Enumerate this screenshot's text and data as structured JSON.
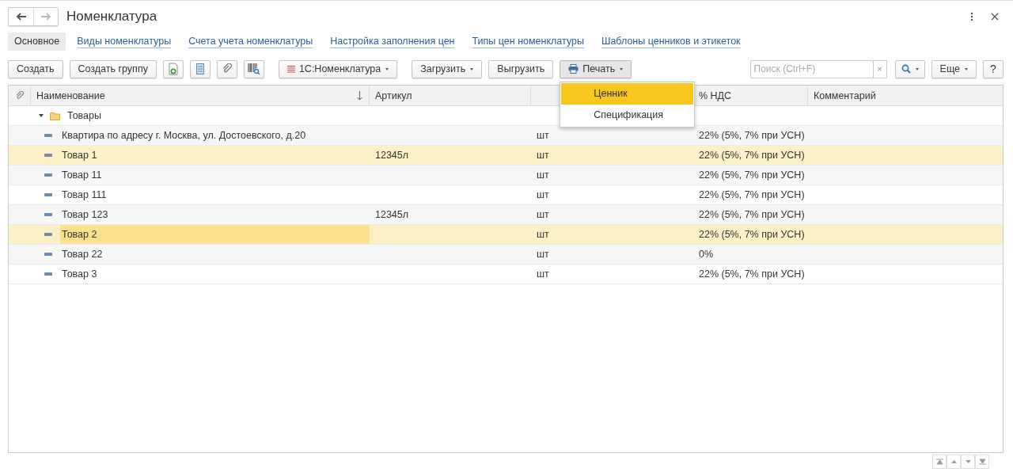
{
  "window": {
    "title": "Номенклатура"
  },
  "nav": {
    "back_disabled": false,
    "forward_disabled": true
  },
  "tabs": [
    {
      "label": "Основное",
      "selected": true
    },
    {
      "label": "Виды номенклатуры",
      "selected": false
    },
    {
      "label": "Счета учета номенклатуры",
      "selected": false
    },
    {
      "label": "Настройка заполнения цен",
      "selected": false
    },
    {
      "label": "Типы цен номенклатуры",
      "selected": false
    },
    {
      "label": "Шаблоны ценников и этикеток",
      "selected": false
    }
  ],
  "toolbar": {
    "main_buttons": [
      {
        "label": "Создать"
      },
      {
        "label": "Создать группу"
      }
    ],
    "buttons": [
      {
        "label": "1С:Номенклатура",
        "kind": "list"
      },
      {
        "label": "Загрузить",
        "kind": "menu"
      },
      {
        "label": "Выгрузить",
        "kind": "button"
      },
      {
        "label": "Печать",
        "kind": "print",
        "expanded": true
      }
    ],
    "print_menu": [
      {
        "label": "Ценник",
        "selected": true
      },
      {
        "label": "Спецификация",
        "selected": false
      }
    ],
    "search": {
      "placeholder": "Поиск (Ctrl+F)"
    },
    "clear": "×",
    "more": "Еще",
    "help": "?"
  },
  "table": {
    "columns": [
      {
        "label": "Наименование",
        "sorted": true
      },
      {
        "label": "Артикул",
        "sorted": false
      },
      null,
      {
        "label": "% НДС",
        "sorted": false
      },
      {
        "label": "Комментарий",
        "sorted": false
      }
    ],
    "rows": [
      {
        "kind": "group",
        "name": "Товары",
        "expanded": true,
        "children": [
          {
            "kind": "item",
            "name": "Квартира по адресу г. Москва, ул. Достоевского, д.20",
            "unit": "шт",
            "vat": "22% (5%, 7% при УСН)",
            "selected": false,
            "current": false
          },
          {
            "kind": "item",
            "name": "Товар 1",
            "article": "12345л",
            "unit": "шт",
            "vat": "22% (5%, 7% при УСН)",
            "selected": true,
            "current": false
          },
          {
            "kind": "item",
            "name": "Товар 11",
            "unit": "шт",
            "vat": "22% (5%, 7% при УСН)",
            "selected": false,
            "current": false
          },
          {
            "kind": "item",
            "name": "Товар 111",
            "unit": "шт",
            "vat": "22% (5%, 7% при УСН)",
            "selected": false,
            "current": false
          },
          {
            "kind": "item",
            "name": "Товар 123",
            "article": "12345л",
            "unit": "шт",
            "vat": "22% (5%, 7% при УСН)",
            "selected": false,
            "current": false
          },
          {
            "kind": "item",
            "name": "Товар 2",
            "unit": "шт",
            "vat": "22% (5%, 7% при УСН)",
            "selected": true,
            "current": true
          },
          {
            "kind": "item",
            "name": "Товар 22",
            "unit": "шт",
            "vat": "0%",
            "selected": false,
            "current": false
          },
          {
            "kind": "item",
            "name": "Товар 3",
            "unit": "шт",
            "vat": "22% (5%, 7% при УСН)",
            "selected": false,
            "current": false
          }
        ]
      }
    ]
  }
}
